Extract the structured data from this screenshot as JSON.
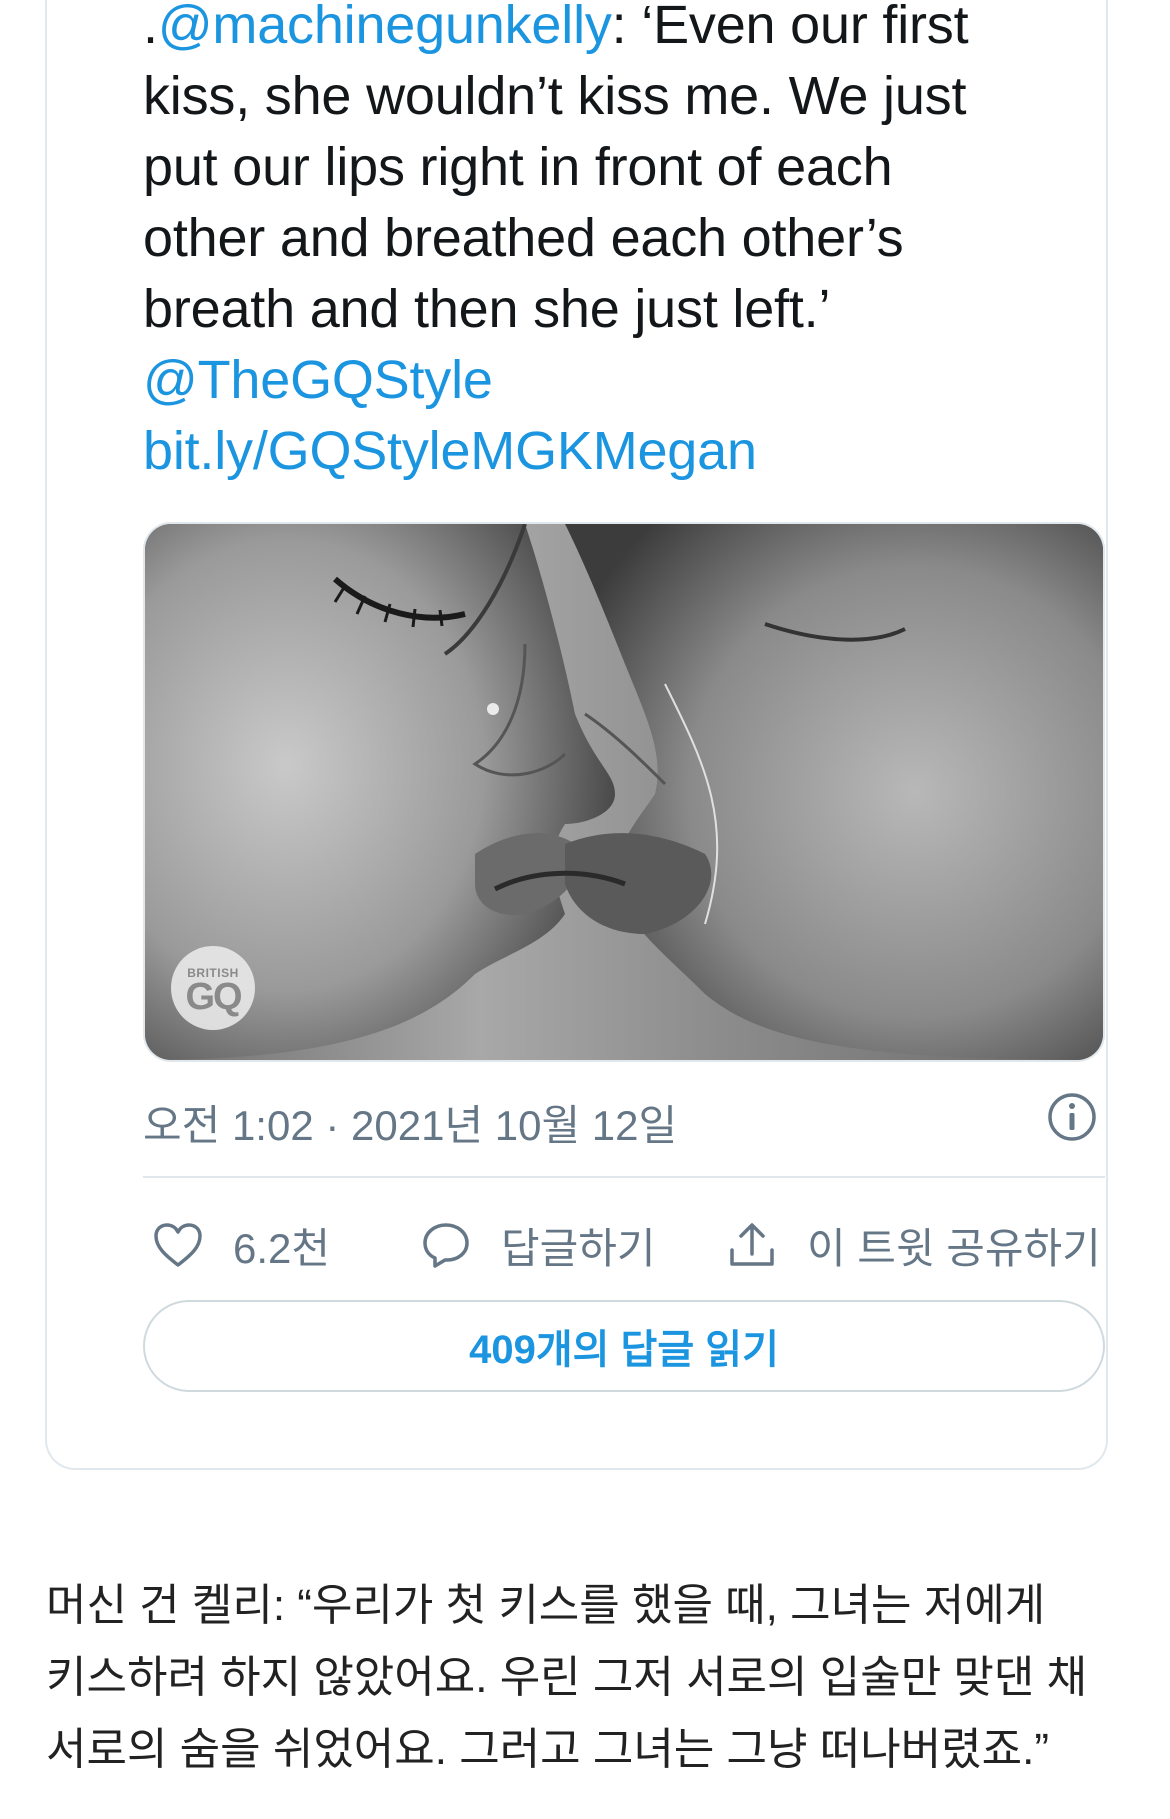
{
  "tweet": {
    "text_line1_prefix": ".",
    "text_line1_mention": "@machinegunkelly",
    "text_line1_rest": ": ‘Even our first",
    "text_line2": "kiss, she wouldn’t kiss me. We just",
    "text_line3": "put our lips right in front of each",
    "text_line4": "other and breathed each other’s",
    "text_line5": "breath and then she just left.’",
    "mention_gq": "@TheGQStyle",
    "link": "bit.ly/GQStyleMGKMegan",
    "media_badge_small": "BRITISH",
    "media_badge_big": "GQ",
    "timestamp": "오전 1:02 · 2021년 10월 12일",
    "like_count": "6.2천",
    "reply_label": "답글하기",
    "share_label": "이 트윗 공유하기",
    "read_replies_label": "409개의 답글 읽기"
  },
  "caption": {
    "line1": "머신 건 켈리: “우리가 첫 키스를 했을 때, 그녀는 저에게",
    "line2": "키스하려 하지 않았어요. 우린 그저 서로의 입술만 맞댄 채",
    "line3": "서로의 숨을 쉬었어요. 그러고 그녀는 그냥 떠나버렸죠.”"
  },
  "colors": {
    "link": "#1b95e0",
    "secondary_text": "#657786",
    "border": "#e1e8ed"
  },
  "icons": {
    "like": "heart-icon",
    "reply": "comment-bubble-icon",
    "share": "share-upload-icon",
    "info": "info-icon"
  }
}
